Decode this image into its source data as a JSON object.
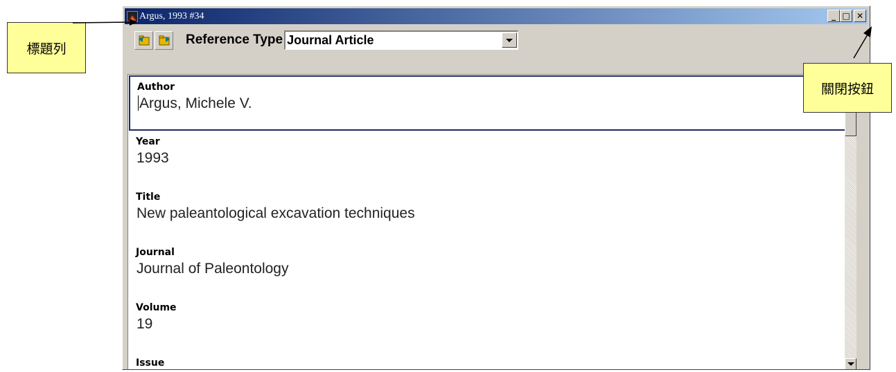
{
  "annotations": {
    "title_bar_label": "標題列",
    "close_button_label": "關閉按鈕"
  },
  "window": {
    "title": "Argus, 1993 #34",
    "controls": {
      "minimize": "_",
      "maximize": "□",
      "close": "✕"
    }
  },
  "toolbar": {
    "reference_type_label": "Reference Type",
    "reference_type_value": "Journal Article"
  },
  "fields": [
    {
      "label": "Author",
      "value": "Argus, Michele V."
    },
    {
      "label": "Year",
      "value": "1993"
    },
    {
      "label": "Title",
      "value": "New paleantological excavation techniques"
    },
    {
      "label": "Journal",
      "value": "Journal of Paleontology"
    },
    {
      "label": "Volume",
      "value": "19"
    },
    {
      "label": "Issue",
      "value": ""
    }
  ],
  "colors": {
    "titlebar_start": "#0a246a",
    "titlebar_end": "#a6caf0",
    "callout_fill": "#ffff99",
    "window_face": "#d4d0c8",
    "focus_border": "#1f2b5c"
  },
  "icons": [
    "app-icon",
    "record-nav-icon",
    "record-nav-icon",
    "dropdown-arrow-icon",
    "scroll-up-icon",
    "scroll-down-icon"
  ]
}
